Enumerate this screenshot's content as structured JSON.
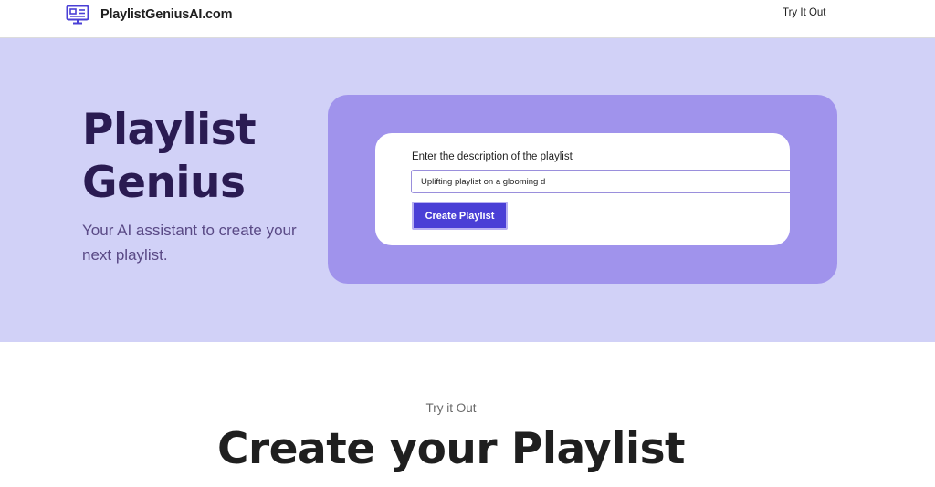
{
  "navbar": {
    "brand_icon": "monitor-icon",
    "brand_name": "PlaylistGeniusAI.com",
    "link_label": "Try It Out"
  },
  "hero": {
    "title_line1": "Playlist",
    "title_line2": "Genius",
    "subtitle": "Your AI assistant to create your next playlist."
  },
  "form": {
    "label": "Enter the description of the playlist",
    "input_value": "Uplifting playlist on a glooming d",
    "button_label": "Create Playlist"
  },
  "section": {
    "eyebrow": "Try it Out",
    "title": "Create your Playlist"
  },
  "colors": {
    "hero_background": "#d1d1f7",
    "panel_background": "#a093ec",
    "button_background": "#4a3fd6",
    "title_color": "#2a1b52",
    "brand_icon_color": "#4a3fd6"
  }
}
